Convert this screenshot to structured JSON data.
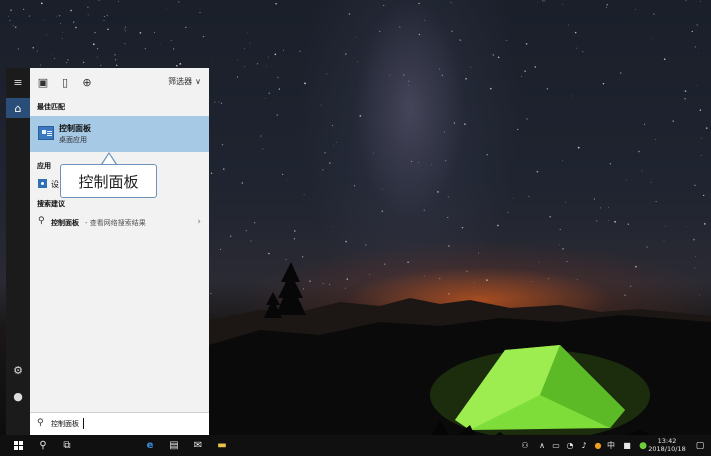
{
  "toolbar": {
    "filter_label": "筛选器",
    "icons": [
      "apps-icon",
      "document-icon",
      "web-icon"
    ]
  },
  "sections": {
    "best_match": "最佳匹配",
    "apps": "应用",
    "web_suggestions": "搜索建议"
  },
  "best_match": {
    "title": "控制面板",
    "subtitle": "桌面应用"
  },
  "app_result": {
    "label": "设"
  },
  "suggestion": {
    "main": "控制面板",
    "sub": "- 查看网络搜索结果"
  },
  "callout": {
    "text": "控制面板"
  },
  "search_box": {
    "query": "控制面板"
  },
  "taskbar": {
    "ime": "中",
    "time": "13:42",
    "date": "2018/10/18"
  },
  "colors": {
    "selection": "#a6c9e6",
    "accent": "#2e6fb5",
    "taskbar": "#101010"
  }
}
